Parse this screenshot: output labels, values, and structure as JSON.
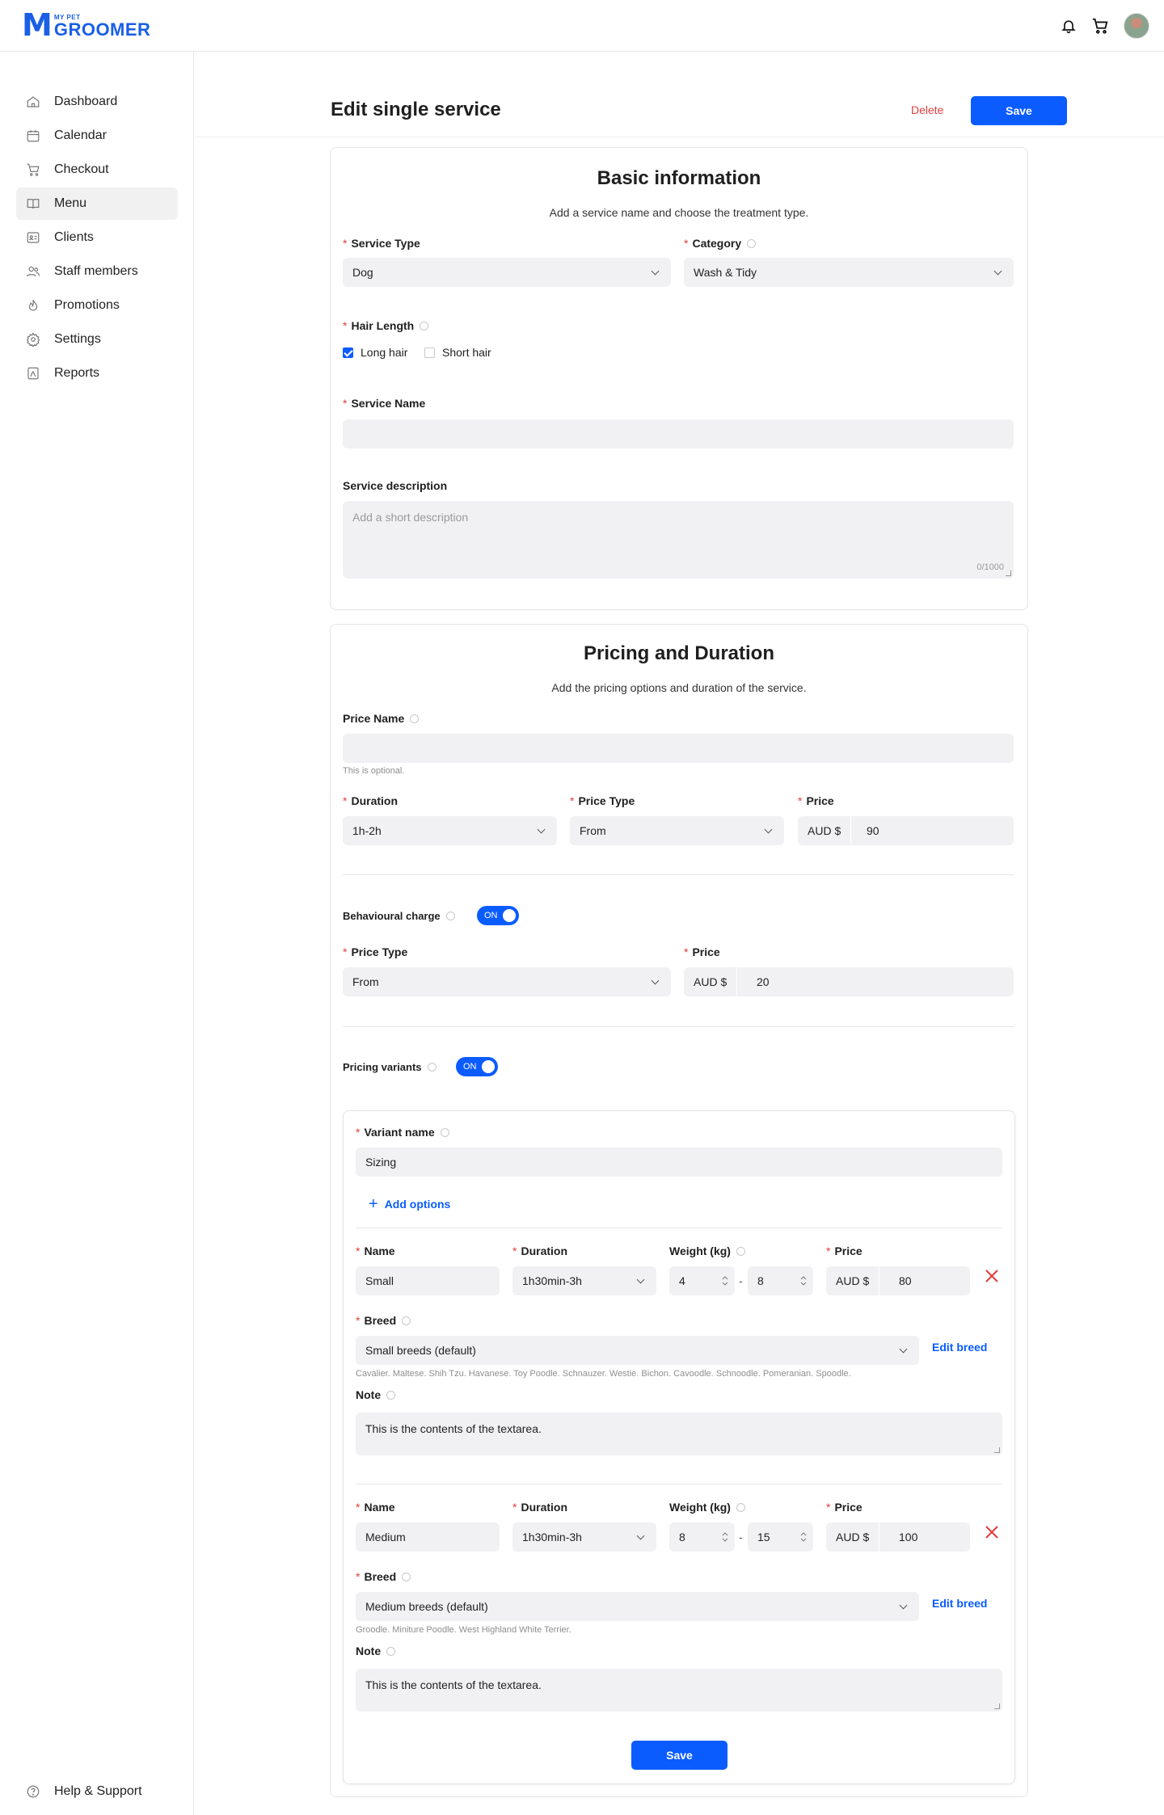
{
  "brand": {
    "small": "MY PET",
    "big": "GROOMER",
    "mark": "M"
  },
  "nav": [
    {
      "label": "Dashboard",
      "icon": "home-icon"
    },
    {
      "label": "Calendar",
      "icon": "calendar-icon"
    },
    {
      "label": "Checkout",
      "icon": "cart-icon"
    },
    {
      "label": "Menu",
      "icon": "menu-book-icon",
      "active": true
    },
    {
      "label": "Clients",
      "icon": "clients-icon"
    },
    {
      "label": "Staff members",
      "icon": "staff-icon"
    },
    {
      "label": "Promotions",
      "icon": "flame-icon"
    },
    {
      "label": "Settings",
      "icon": "gear-icon"
    },
    {
      "label": "Reports",
      "icon": "report-icon"
    }
  ],
  "help_label": "Help & Support",
  "page": {
    "title": "Edit single service",
    "delete_label": "Delete",
    "save_label": "Save"
  },
  "basic": {
    "title": "Basic information",
    "subtitle": "Add a service name and choose the treatment type.",
    "service_type_label": "Service Type",
    "service_type_value": "Dog",
    "category_label": "Category",
    "category_value": "Wash & Tidy",
    "hair_length_label": "Hair Length",
    "long_hair": "Long hair",
    "short_hair": "Short hair",
    "service_name_label": "Service Name",
    "service_name_value": "",
    "description_label": "Service description",
    "description_placeholder": "Add a short description",
    "description_count": "0/1000"
  },
  "pricing": {
    "title": "Pricing and Duration",
    "subtitle": "Add the pricing options and duration of the service.",
    "price_name_label": "Price Name",
    "price_name_hint": "This is optional.",
    "duration_label": "Duration",
    "duration_value": "1h-2h",
    "price_type_label": "Price Type",
    "price_type_value": "From",
    "price_label": "Price",
    "currency": "AUD $",
    "price_value": "90",
    "behavioural_label": "Behavioural charge",
    "toggle_on": "ON",
    "behav_price_type_label": "Price Type",
    "behav_price_type_value": "From",
    "behav_price_label": "Price",
    "behav_price_value": "20",
    "variants_label": "Pricing variants"
  },
  "variant": {
    "name_label": "Variant name",
    "name_value": "Sizing",
    "add_options": "Add options",
    "col_name": "Name",
    "col_duration": "Duration",
    "col_weight": "Weight (kg)",
    "col_price": "Price",
    "breed_label": "Breed",
    "note_label": "Note",
    "edit_breed": "Edit breed",
    "dash": "-",
    "options": [
      {
        "name": "Small",
        "duration": "1h30min-3h",
        "w_min": "4",
        "w_max": "8",
        "price": "80",
        "breed": "Small breeds (default)",
        "breed_list": "Cavalier. Maltese. Shih Tzu. Havanese. Toy Poodle. Schnauzer. Westie. Bichon. Cavoodle. Schnoodle. Pomeranian. Spoodle.",
        "note": "This is the contents of the textarea."
      },
      {
        "name": "Medium",
        "duration": "1h30min-3h",
        "w_min": "8",
        "w_max": "15",
        "price": "100",
        "breed": "Medium breeds (default)",
        "breed_list": "Groodle. Miniture Poodle. West Highland White Terrier.",
        "note": "This is the contents of the textarea."
      }
    ],
    "save_label": "Save"
  }
}
